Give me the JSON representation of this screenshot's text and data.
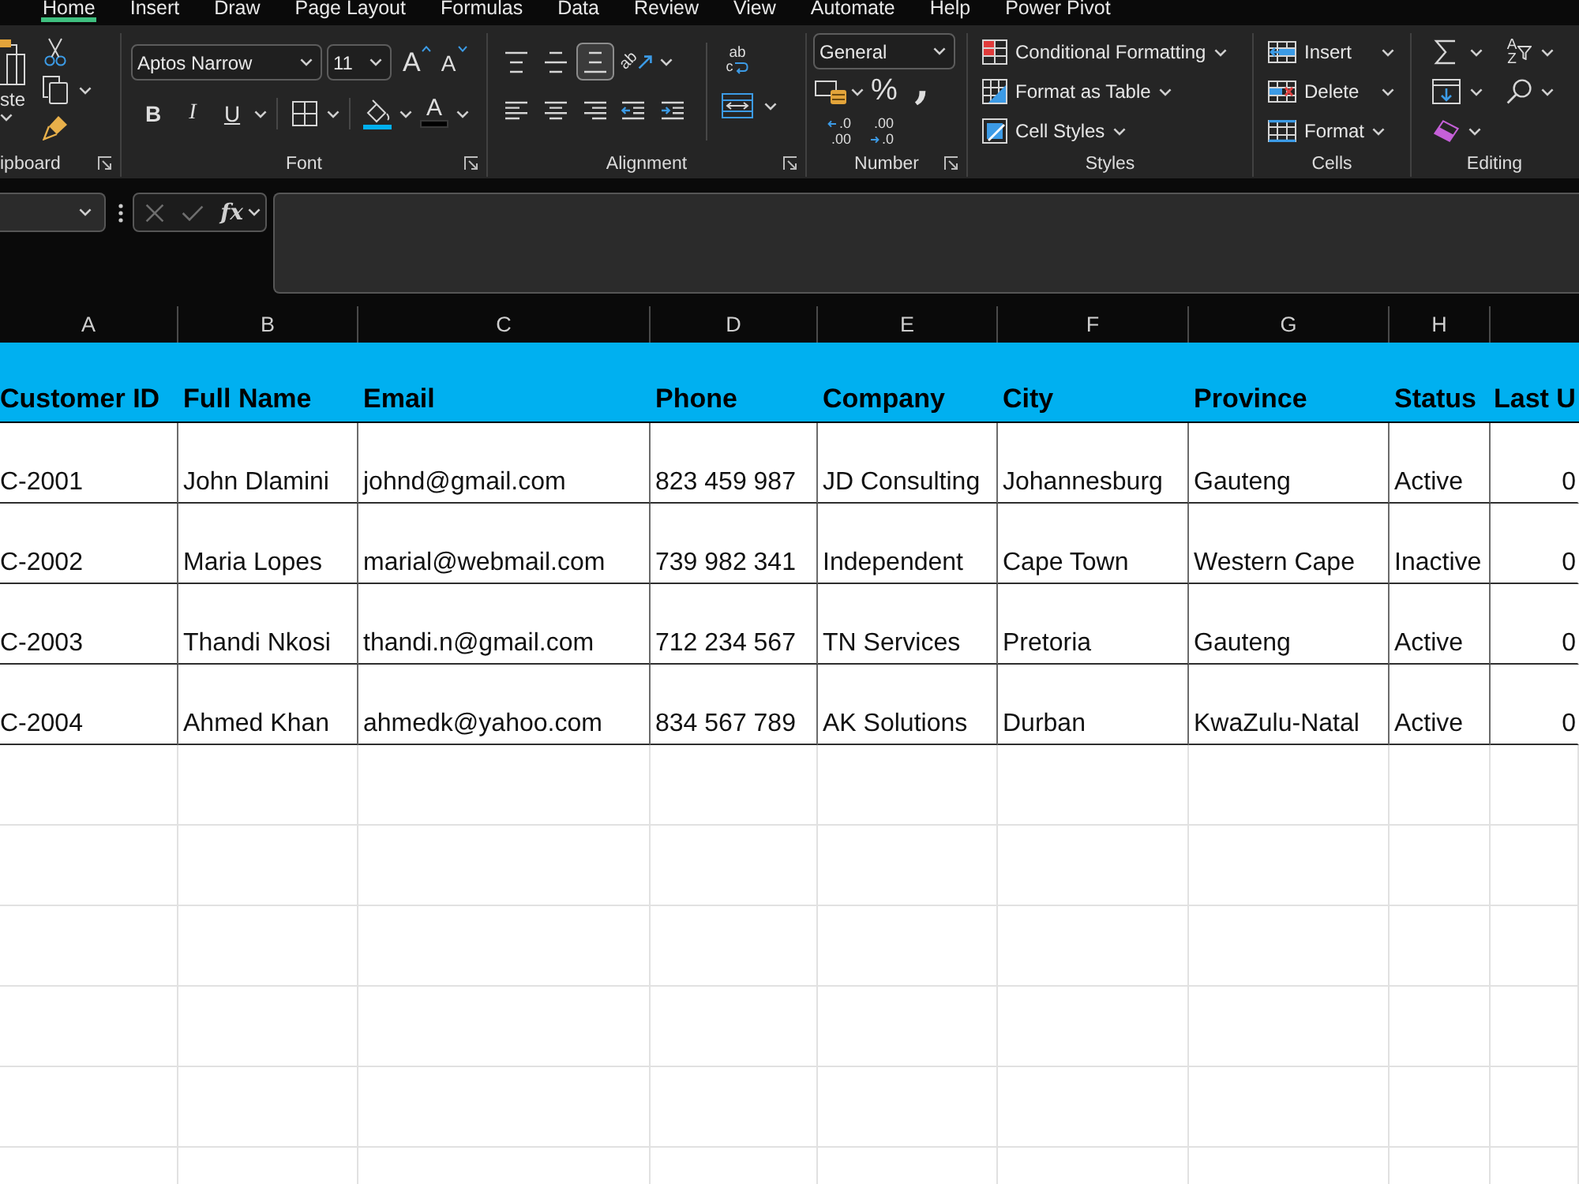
{
  "ribbon_tabs": [
    {
      "label": "Home",
      "selected": true
    },
    {
      "label": "Insert",
      "selected": false
    },
    {
      "label": "Draw",
      "selected": false
    },
    {
      "label": "Page Layout",
      "selected": false
    },
    {
      "label": "Formulas",
      "selected": false
    },
    {
      "label": "Data",
      "selected": false
    },
    {
      "label": "Review",
      "selected": false
    },
    {
      "label": "View",
      "selected": false
    },
    {
      "label": "Automate",
      "selected": false
    },
    {
      "label": "Help",
      "selected": false
    },
    {
      "label": "Power Pivot",
      "selected": false
    }
  ],
  "clipboard": {
    "paste": "ste",
    "label": "ipboard"
  },
  "font": {
    "name": "Aptos Narrow",
    "size": "11",
    "grow": "A",
    "shrink": "A",
    "bold": "B",
    "italic": "I",
    "underline": "U",
    "font_color": "A",
    "label": "Font"
  },
  "alignment": {
    "vertical": [
      {
        "kind": "top",
        "selected": false
      },
      {
        "kind": "middle",
        "selected": false
      },
      {
        "kind": "bottom",
        "selected": true
      }
    ],
    "horizontal": [
      {
        "kind": "left",
        "selected": false
      },
      {
        "kind": "center",
        "selected": false
      },
      {
        "kind": "right",
        "selected": false
      }
    ],
    "orientation": "ab",
    "wrap_top": "ab",
    "wrap_bottom": "c",
    "label": "Alignment"
  },
  "number": {
    "format": "General",
    "percent": "%",
    "comma": ",",
    "decimal_buttons": [
      {
        "kind": "increase",
        "top": ".0",
        "bottom": ".00"
      },
      {
        "kind": "decrease",
        "top": ".00",
        "bottom": ".0"
      }
    ],
    "label": "Number"
  },
  "styles": {
    "items": [
      {
        "kind": "conditional",
        "label": "Conditional Formatting"
      },
      {
        "kind": "table",
        "label": "Format as Table"
      },
      {
        "kind": "cell",
        "label": "Cell Styles"
      }
    ],
    "label": "Styles"
  },
  "cells": {
    "items": [
      {
        "kind": "insert",
        "label": "Insert"
      },
      {
        "kind": "delete",
        "label": "Delete"
      },
      {
        "kind": "format",
        "label": "Format"
      }
    ],
    "label": "Cells"
  },
  "editing": {
    "sort_top": "A",
    "sort_bottom": "Z",
    "label": "Editing"
  },
  "formula_bar": {
    "function_label": "fx"
  },
  "sheet": {
    "column_letters": [
      "A",
      "B",
      "C",
      "D",
      "E",
      "F",
      "G",
      "H"
    ],
    "header_row": [
      "Customer ID",
      "Full Name",
      "Email",
      "Phone",
      "Company",
      "City",
      "Province",
      "Status",
      "Last U"
    ],
    "rows": [
      [
        "C-2001",
        "John Dlamini",
        "johnd@gmail.com",
        "823 459 987",
        "JD Consulting",
        "Johannesburg",
        "Gauteng",
        "Active",
        "0"
      ],
      [
        "C-2002",
        "Maria Lopes",
        "marial@webmail.com",
        "739 982 341",
        "Independent",
        "Cape Town",
        "Western Cape",
        "Inactive",
        "0"
      ],
      [
        "C-2003",
        "Thandi Nkosi",
        "thandi.n@gmail.com",
        "712 234 567",
        "TN Services",
        "Pretoria",
        "Gauteng",
        "Active",
        "0"
      ],
      [
        "C-2004",
        "Ahmed Khan",
        "ahmedk@yahoo.com",
        "834 567 789",
        "AK Solutions",
        "Durban",
        "KwaZulu-Natal",
        "Active",
        "0"
      ]
    ]
  }
}
